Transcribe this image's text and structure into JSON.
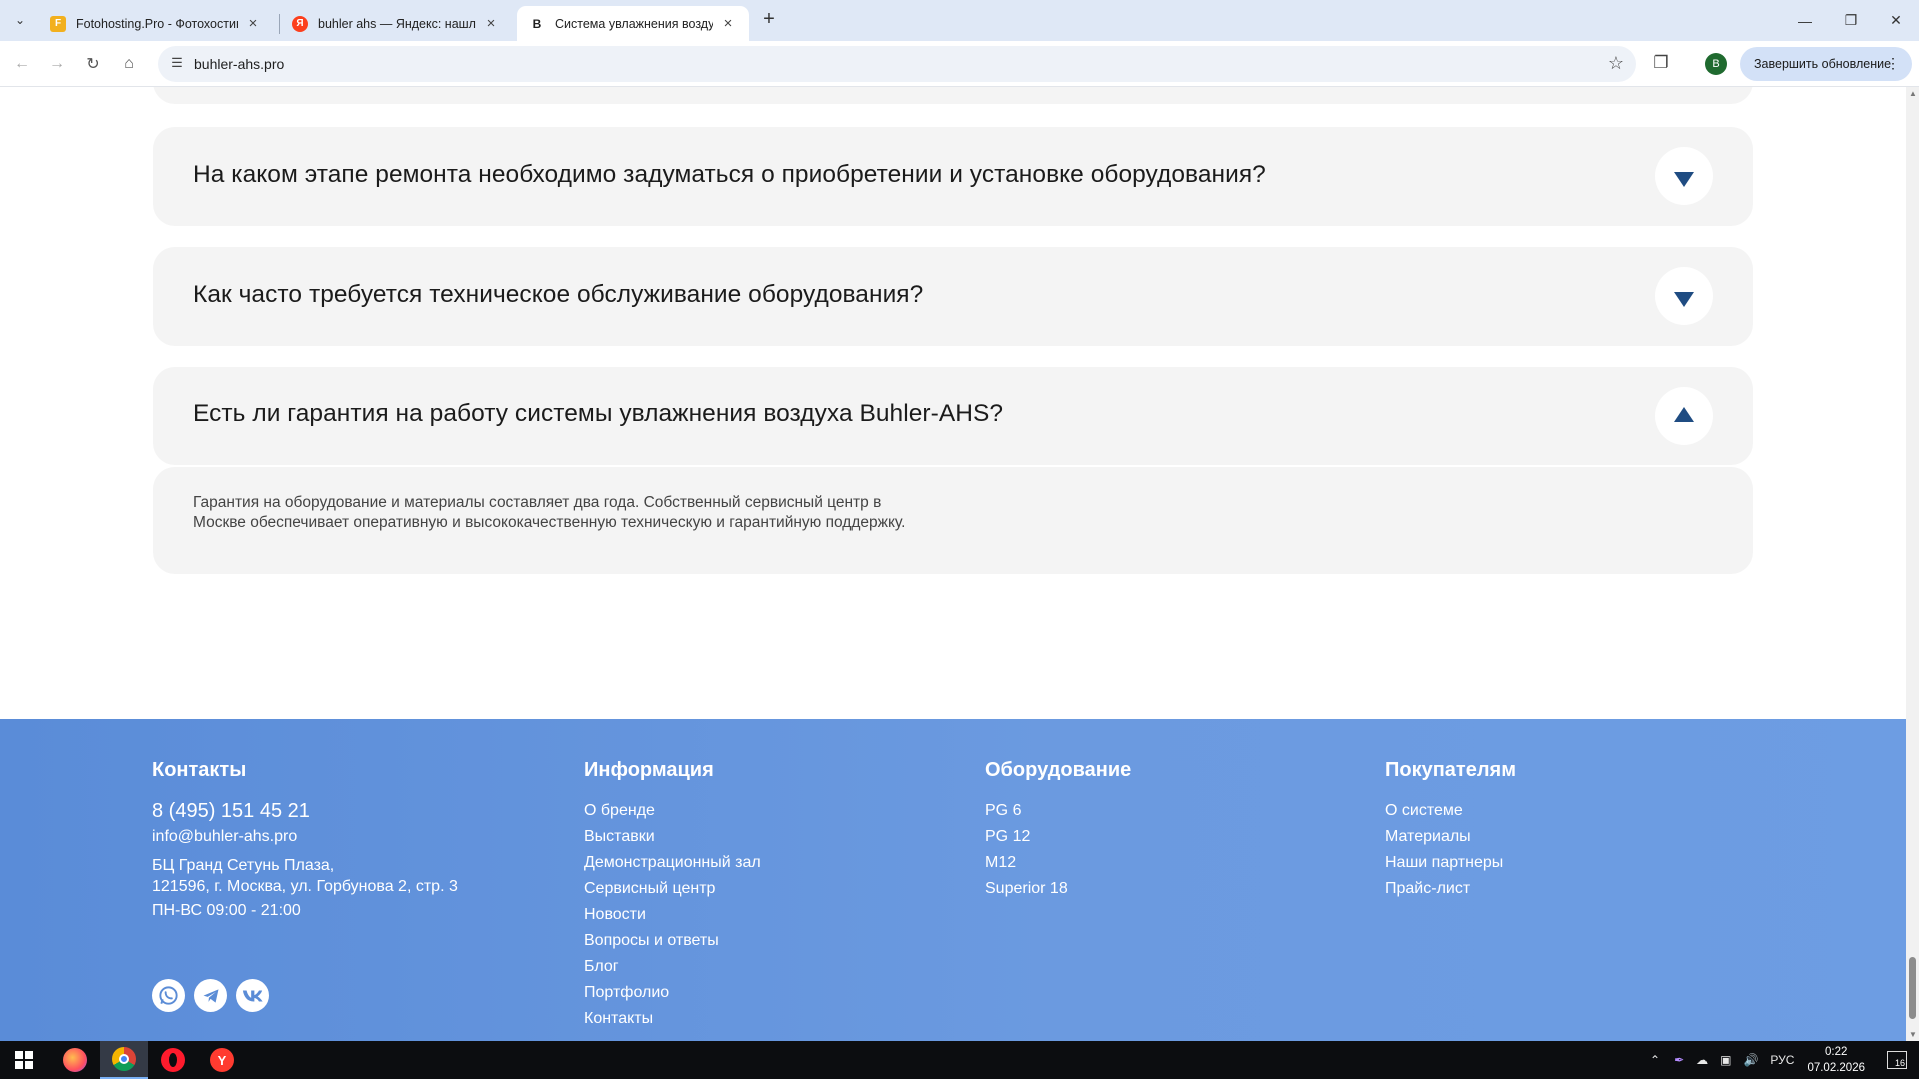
{
  "browser": {
    "tabs": [
      {
        "title": "Fotohosting.Pro - Фотохостинг",
        "favicon": "fotohosting-icon",
        "active": false
      },
      {
        "title": "buhler ahs — Яндекс: нашлось",
        "favicon": "yandex-icon",
        "active": false
      },
      {
        "title": "Система увлажнения воздуха",
        "favicon": "buhler-icon",
        "active": true
      }
    ],
    "url": "buhler-ahs.pro",
    "profile_letter": "B",
    "update_label": "Завершить обновление"
  },
  "faq": {
    "items": [
      {
        "question": "На каком этапе ремонта необходимо задуматься о приобретении и установке оборудования?",
        "expanded": false
      },
      {
        "question": "Как часто требуется техническое обслуживание оборудования?",
        "expanded": false
      },
      {
        "question": "Есть ли гарантия на работу системы увлажнения воздуха Buhler-AHS?",
        "expanded": true
      }
    ],
    "answer": "Гарантия на оборудование и материалы составляет два года. Собственный сервисный центр в Москве обеспечивает оперативную и высококачественную техническую и гарантийную поддержку."
  },
  "footer": {
    "contacts": {
      "heading": "Контакты",
      "phone": "8 (495) 151 45 21",
      "email": "info@buhler-ahs.pro",
      "address_line1": "БЦ Гранд Сетунь Плаза,",
      "address_line2": "121596, г. Москва, ул. Горбунова 2, стр. 3",
      "hours": "ПН-ВС 09:00 - 21:00",
      "socials": [
        "whatsapp-icon",
        "telegram-icon",
        "vk-icon"
      ]
    },
    "info": {
      "heading": "Информация",
      "links": [
        "О бренде",
        "Выставки",
        "Демонстрационный зал",
        "Сервисный центр",
        "Новости",
        "Вопросы и ответы",
        "Блог",
        "Портфолио",
        "Контакты"
      ]
    },
    "equipment": {
      "heading": "Оборудование",
      "links": [
        "PG 6",
        "PG 12",
        "M12",
        "Superior 18"
      ]
    },
    "buyers": {
      "heading": "Покупателям",
      "links": [
        "О системе",
        "Материалы",
        "Наши партнеры",
        "Прайс-лист"
      ]
    }
  },
  "taskbar": {
    "apps": [
      "firefox-icon",
      "chrome-icon",
      "opera-icon",
      "yandex-browser-icon"
    ],
    "language": "РУС",
    "time": "0:22",
    "date": "07.02.2026",
    "notifications": "16"
  },
  "colors": {
    "accent": "#1f4c82",
    "footer_bg": "#6496de",
    "card_bg": "#f4f4f4"
  }
}
